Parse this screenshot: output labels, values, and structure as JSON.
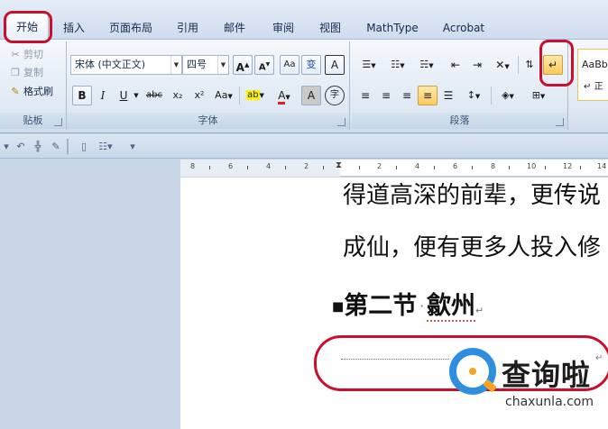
{
  "tabs": [
    "开始",
    "插入",
    "页面布局",
    "引用",
    "邮件",
    "审阅",
    "视图",
    "MathType",
    "Acrobat"
  ],
  "clipboard": {
    "cut": "剪切",
    "copy": "复制",
    "format_painter": "格式刷",
    "group_label": "贴板"
  },
  "font": {
    "name": "宋体 (中文正文)",
    "size": "四号",
    "grow": "A",
    "shrink": "A",
    "clear": "Aa",
    "phonetic": "变",
    "border_char": "A",
    "bold": "B",
    "italic": "I",
    "underline": "U",
    "strike": "abc",
    "subscript": "x₂",
    "superscript": "x²",
    "change_case": "Aa",
    "highlight": "ab",
    "font_color": "A",
    "shading": "A",
    "enclose": "字",
    "group_label": "字体"
  },
  "paragraph": {
    "group_label": "段落"
  },
  "styles": {
    "sample": "AaBb",
    "label": "正"
  },
  "ruler": {
    "left_numbers": [
      "8",
      "6",
      "4",
      "2"
    ],
    "right_numbers": [
      "2",
      "4",
      "6",
      "8",
      "10",
      "12",
      "14"
    ]
  },
  "document": {
    "line1": "得道高深的前辈，更传说",
    "line2": "成仙，便有更多人投入修",
    "heading_part1": "第二节",
    "heading_part2": "歙州",
    "para_mark": "↵"
  },
  "watermark": {
    "title": "查询啦",
    "subtitle": "chaxunla.com"
  },
  "colors": {
    "highlight_annotation": "#c8102e",
    "active_button": "#ffc95a",
    "watermark_blue": "#2f8fde",
    "watermark_orange": "#f5a623"
  }
}
